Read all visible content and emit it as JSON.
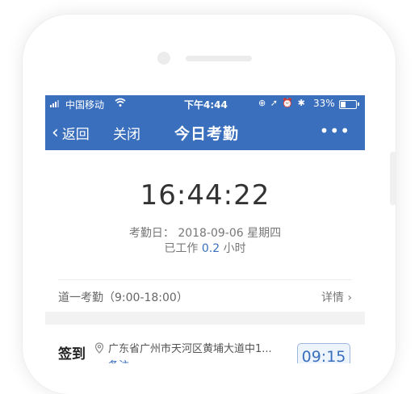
{
  "status_bar": {
    "carrier": "中国移动",
    "time": "下午4:44",
    "icons": "⊕ ➚ ⏰ ✱",
    "battery_percent": "33%"
  },
  "nav": {
    "back_label": "返回",
    "close_label": "关闭",
    "title": "今日考勤",
    "more_label": "•••"
  },
  "attendance": {
    "clock": "16:44:22",
    "date_label": "考勤日：",
    "date": "2018-09-06",
    "weekday": "星期四",
    "worked_prefix": "已工作",
    "worked_hours": "0.2",
    "worked_unit": "小时"
  },
  "rule": {
    "name": "道一考勤（9:00-18:00）",
    "detail_label": "详情 ›"
  },
  "checkin": {
    "label": "签到",
    "address": "广东省广州市天河区黄埔大道中1...",
    "note": "备注",
    "time": "09:15"
  },
  "colors": {
    "brand": "#3a6fbe"
  }
}
